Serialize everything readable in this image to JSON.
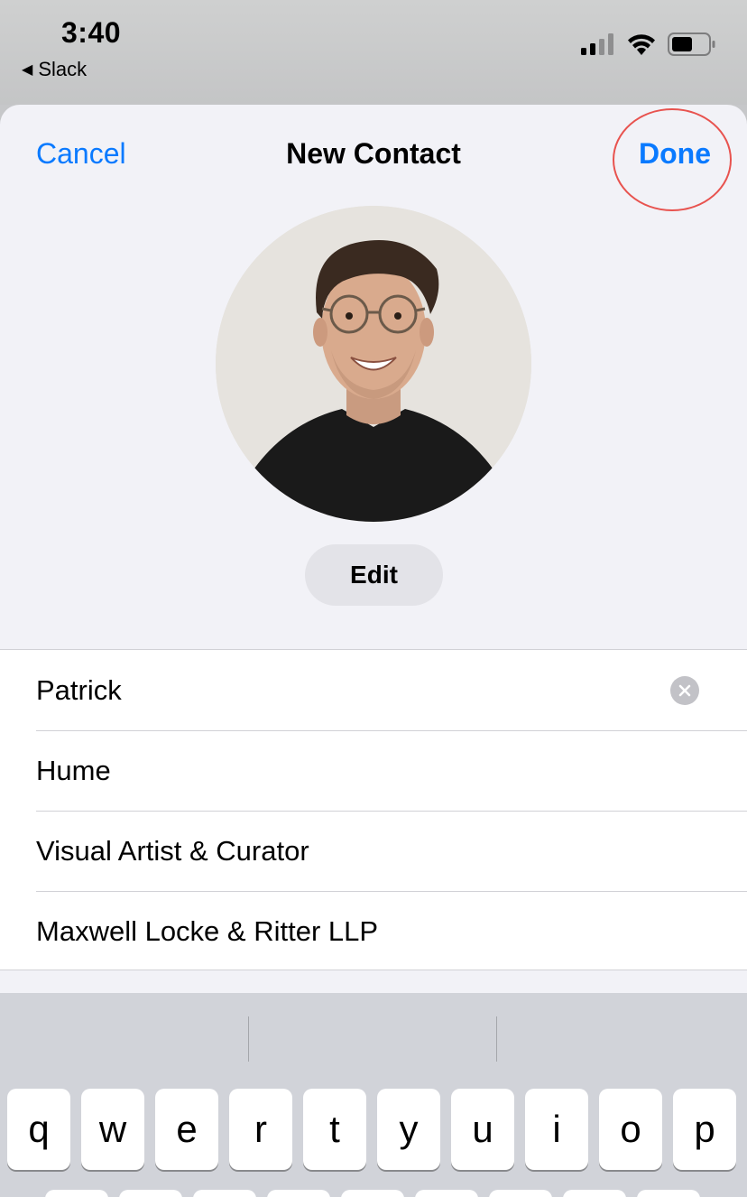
{
  "status_bar": {
    "time": "3:40",
    "back_app": "Slack",
    "back_icon": "back-triangle-icon",
    "signal_icon": "cellular-signal-icon",
    "wifi_icon": "wifi-icon",
    "battery_icon": "battery-icon"
  },
  "nav": {
    "cancel_label": "Cancel",
    "title": "New Contact",
    "done_label": "Done"
  },
  "photo": {
    "edit_label": "Edit"
  },
  "fields": [
    {
      "value": "Patrick",
      "has_clear": true
    },
    {
      "value": "Hume"
    },
    {
      "value": "Visual Artist & Curator"
    },
    {
      "value": "Maxwell Locke & Ritter LLP"
    }
  ],
  "keyboard": {
    "row1": [
      "q",
      "w",
      "e",
      "r",
      "t",
      "y",
      "u",
      "i",
      "o",
      "p"
    ]
  },
  "colors": {
    "accent": "#0a7aff",
    "annotation_ring": "#e8534f"
  }
}
